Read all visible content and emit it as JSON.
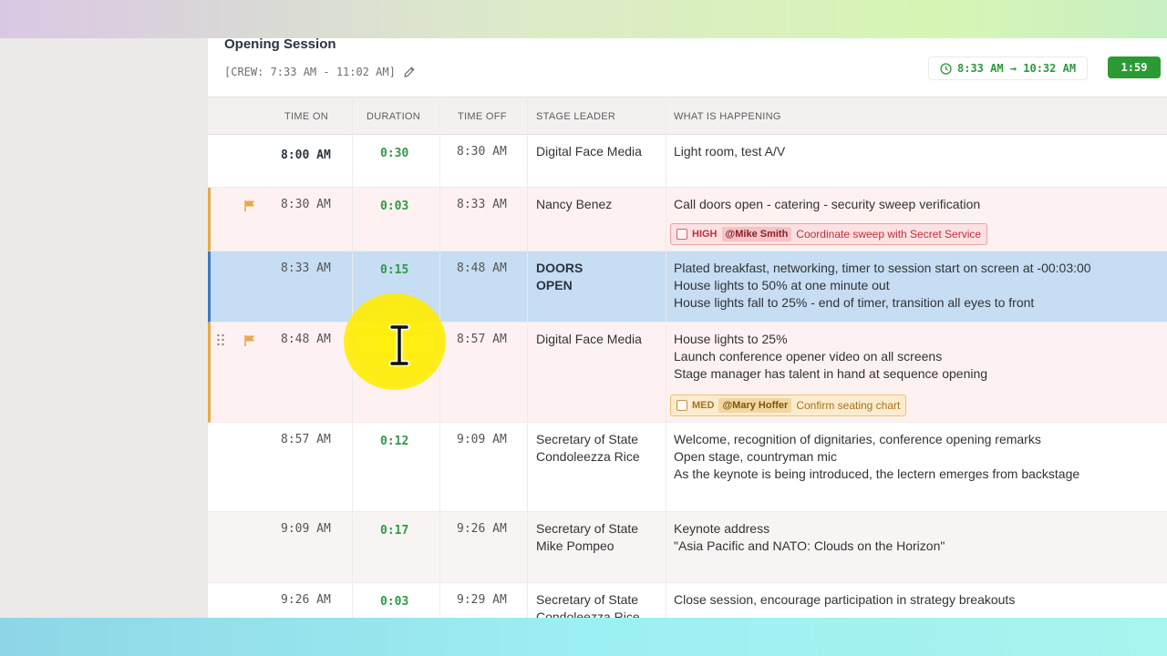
{
  "session": {
    "title": "Opening Session",
    "crew_line": "[CREW: 7:33 AM - 11:02 AM]",
    "time_range": "8:33 AM → 10:32 AM",
    "duration": "1:59"
  },
  "columns": {
    "time_on": "TIME ON",
    "duration": "DURATION",
    "time_off": "TIME OFF",
    "stage_leader": "STAGE LEADER",
    "what": "WHAT IS HAPPENING"
  },
  "rows": [
    {
      "time_on": "8:00 AM",
      "duration": "0:30",
      "time_off": "8:30 AM",
      "leader": [
        "Digital Face Media"
      ],
      "what": [
        "Light room, test A/V"
      ]
    },
    {
      "time_on": "8:30 AM",
      "duration": "0:03",
      "time_off": "8:33 AM",
      "leader": [
        "Nancy Benez"
      ],
      "what": [
        "Call doors open - catering - security sweep verification"
      ],
      "task": {
        "priority": "HIGH",
        "assignee": "@Mike Smith",
        "text": "Coordinate sweep with Secret Service"
      }
    },
    {
      "time_on": "8:33 AM",
      "duration": "0:15",
      "time_off": "8:48 AM",
      "leader": [
        "DOORS",
        "OPEN"
      ],
      "what": [
        "Plated breakfast, networking, timer to session start on screen at -00:03:00",
        "House lights to 50% at one minute out",
        "House lights fall to 25% - end of timer, transition all eyes to front"
      ]
    },
    {
      "time_on": "8:48 AM",
      "duration": "",
      "time_off": "8:57 AM",
      "leader": [
        "Digital Face Media"
      ],
      "what": [
        "House lights to 25%",
        "Launch conference opener video on all screens",
        "Stage manager has talent in hand at sequence opening"
      ],
      "task": {
        "priority": "MED",
        "assignee": "@Mary Hoffer",
        "text": "Confirm seating chart"
      }
    },
    {
      "time_on": "8:57 AM",
      "duration": "0:12",
      "time_off": "9:09 AM",
      "leader": [
        "Secretary of State",
        "Condoleezza Rice"
      ],
      "what": [
        "Welcome, recognition of dignitaries, conference opening remarks",
        "Open stage, countryman mic",
        "As the keynote is being introduced, the lectern emerges from backstage"
      ]
    },
    {
      "time_on": "9:09 AM",
      "duration": "0:17",
      "time_off": "9:26 AM",
      "leader": [
        "Secretary of State",
        "Mike Pompeo"
      ],
      "what": [
        "Keynote address",
        "\"Asia Pacific and NATO: Clouds on the Horizon\""
      ]
    },
    {
      "time_on": "9:26 AM",
      "duration": "0:03",
      "time_off": "9:29 AM",
      "leader": [
        "Secretary of State",
        "Condoleezza Rice"
      ],
      "what": [
        "Close session, encourage participation in strategy breakouts"
      ]
    }
  ],
  "icons": {
    "flag": "flag-icon",
    "clock": "clock-icon",
    "pencil": "pencil-icon",
    "drag": "drag-handle-icon",
    "cursor": "ibeam-cursor-icon"
  },
  "colors": {
    "green": "#2b9a35",
    "flag": "#e9a84b",
    "current_row": "#c6ddf4",
    "high": "#c0303c",
    "med": "#a5731c"
  }
}
